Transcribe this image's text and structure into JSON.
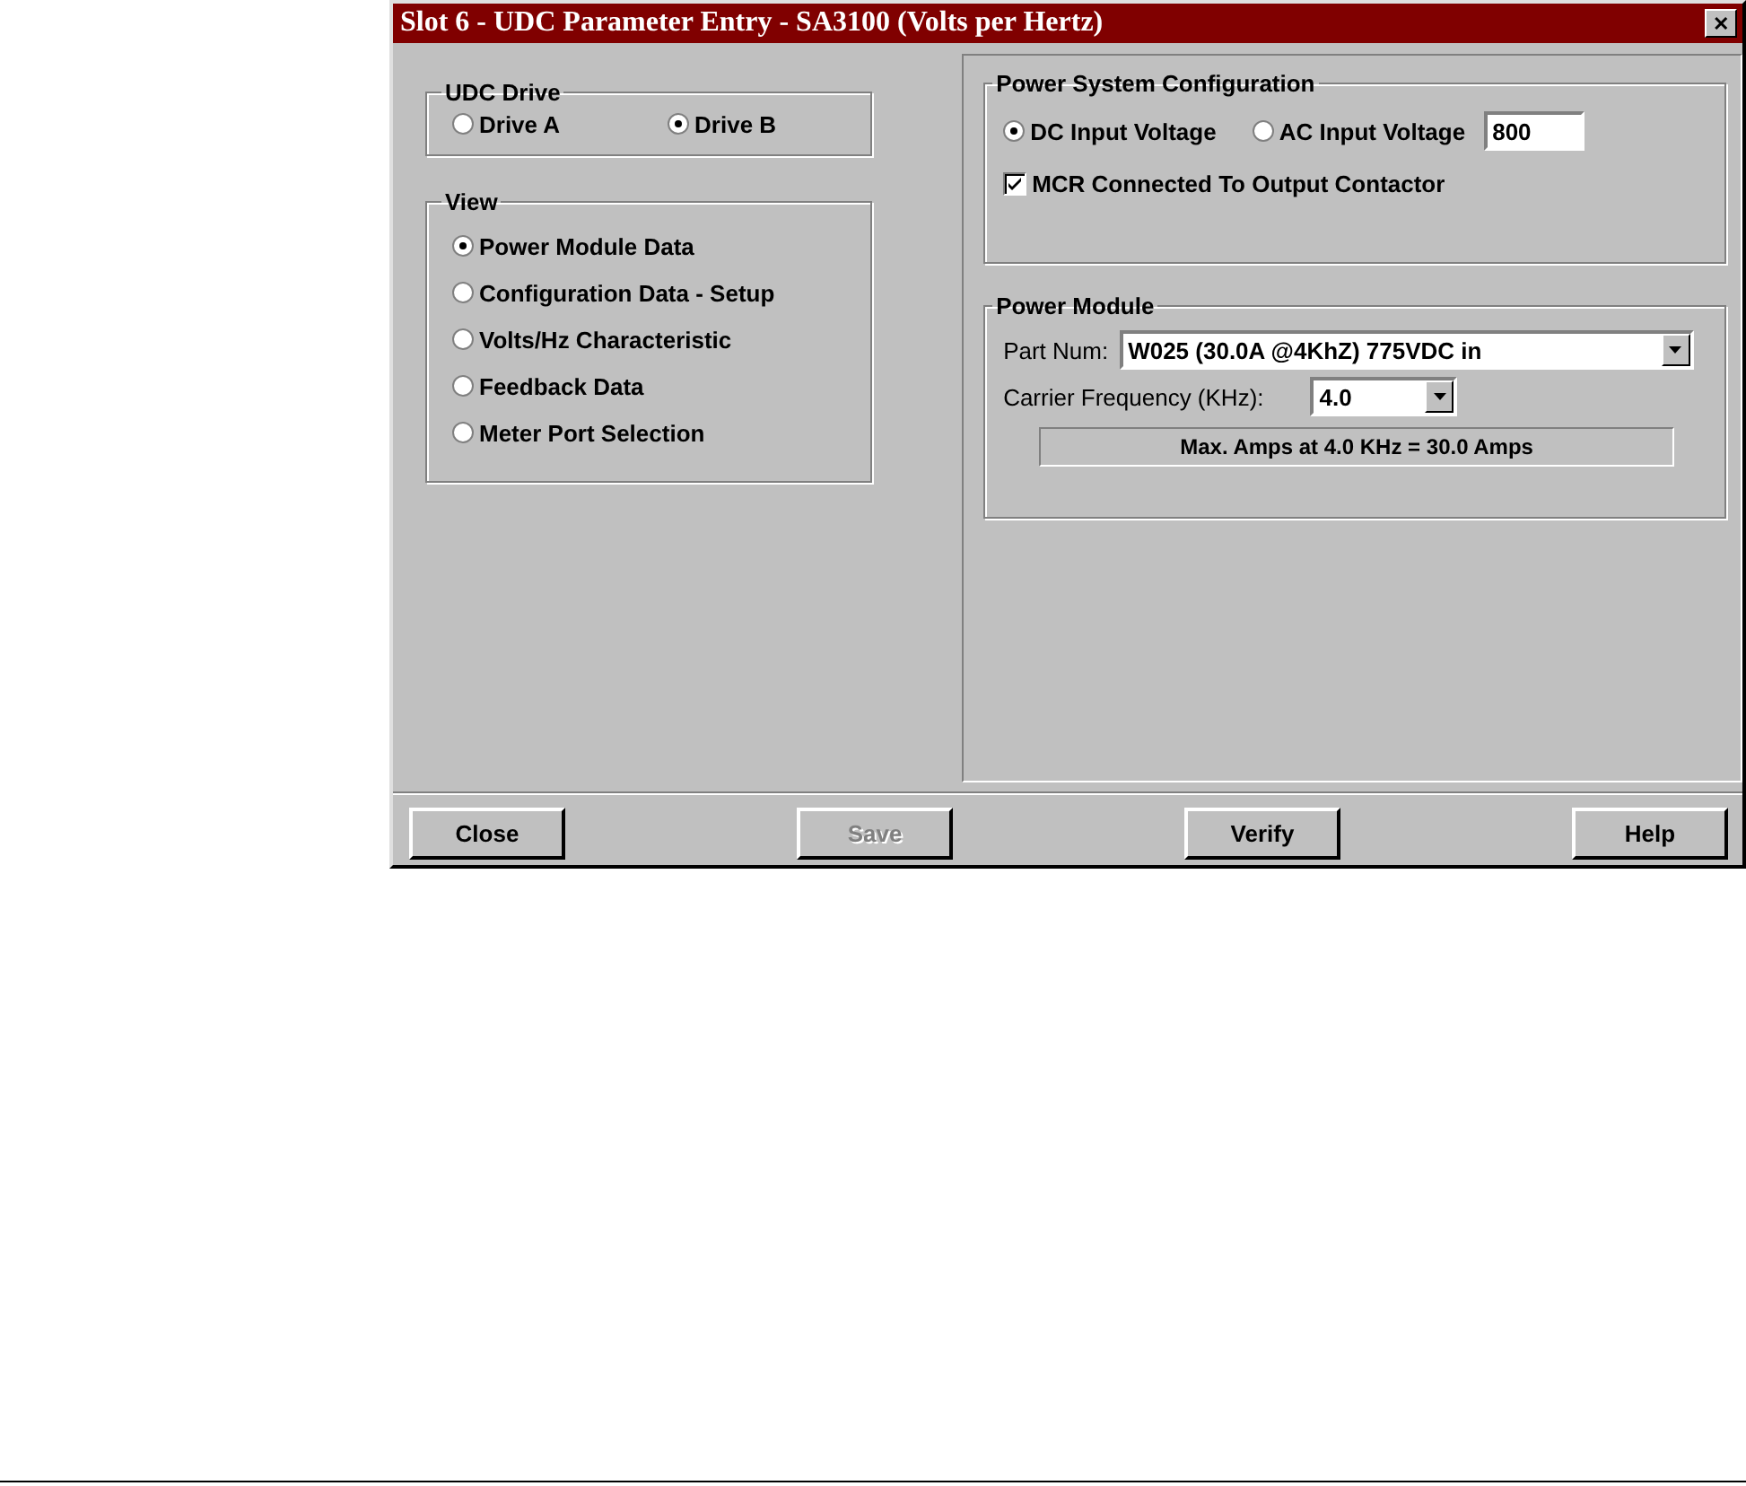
{
  "window": {
    "title": "Slot 6 - UDC Parameter Entry - SA3100 (Volts per Hertz)",
    "close_glyph": "✕"
  },
  "udc_drive": {
    "title": "UDC Drive",
    "options": [
      {
        "label": "Drive A",
        "selected": false
      },
      {
        "label": "Drive B",
        "selected": true
      }
    ]
  },
  "view": {
    "title": "View",
    "options": [
      {
        "label": "Power Module Data",
        "selected": true
      },
      {
        "label": "Configuration Data - Setup",
        "selected": false
      },
      {
        "label": "Volts/Hz Characteristic",
        "selected": false
      },
      {
        "label": "Feedback Data",
        "selected": false
      },
      {
        "label": "Meter Port Selection",
        "selected": false
      }
    ]
  },
  "power_system_configuration": {
    "title": "Power System Configuration",
    "input_options": [
      {
        "label": "DC Input Voltage",
        "selected": true
      },
      {
        "label": "AC Input Voltage",
        "selected": false
      }
    ],
    "voltage": "800",
    "mcr": {
      "label": "MCR Connected To Output Contactor",
      "checked": true
    }
  },
  "power_module": {
    "title": "Power Module",
    "part_num_label": "Part Num:",
    "part_num": "W025 (30.0A @4KhZ) 775VDC in",
    "carrier_label": "Carrier Frequency (KHz):",
    "carrier": "4.0",
    "max_amps": "Max. Amps at 4.0 KHz = 30.0 Amps"
  },
  "buttons": [
    {
      "label": "Close",
      "disabled": false
    },
    {
      "label": "Save",
      "disabled": true
    },
    {
      "label": "Verify",
      "disabled": false
    },
    {
      "label": "Help",
      "disabled": false
    }
  ]
}
